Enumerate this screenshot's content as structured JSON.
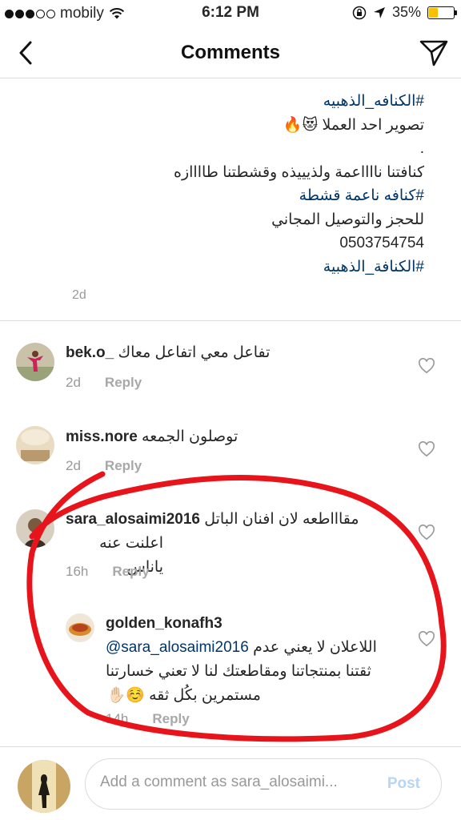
{
  "status_bar": {
    "carrier": "mobily",
    "time": "6:12 PM",
    "battery": "35%",
    "battery_level": 0.35,
    "signal_bars": 3,
    "signal_total": 5
  },
  "nav": {
    "title": "Comments",
    "back_icon": "chevron-left-icon",
    "send_icon": "paper-plane-icon"
  },
  "caption": {
    "lines": [
      "#الكنافه_الذهبيه",
      "تصوير احد العملا 😻🔥",
      ".",
      "كنافتنا نااااعمة ولذيييذه وقشطتنا طاااازه",
      "#كنافه ناعمة قشطة",
      "للحجز والتوصيل المجاني",
      "0503754754",
      "#الكنافة_الذهبية"
    ],
    "time": "2d"
  },
  "comments": [
    {
      "username": "bek.o_",
      "text": "تفاعل معي اتفاعل معاك",
      "time": "2d",
      "reply_label": "Reply"
    },
    {
      "username": "miss.nore",
      "text": "توصلون الجمعه",
      "time": "2d",
      "reply_label": "Reply"
    },
    {
      "username": "sara_alosaimi2016",
      "text_line1": "مقاااطعه لان افنان الباتل",
      "text_line2": "اعلنت عنه ياناس",
      "time": "16h",
      "reply_label": "Reply"
    }
  ],
  "reply": {
    "username": "golden_konafh3",
    "mention": "@sara_alosaimi2016",
    "text_line1": "اللاعلان لا يعني عدم",
    "text_line2": "ثقتنا بمنتجاتنا ومقاطعتك لنا لا تعني خسارتنا",
    "text_line3": "مستمرين بكُل ثقه ☺️✋🏻",
    "time": "14h",
    "reply_label": "Reply"
  },
  "input": {
    "placeholder": "Add a comment as sara_alosaimi...",
    "post_label": "Post"
  },
  "colors": {
    "hashtag": "#003569",
    "annotation": "#e8141b",
    "battery": "#f6c100",
    "post_disabled": "#b7d6f5"
  }
}
